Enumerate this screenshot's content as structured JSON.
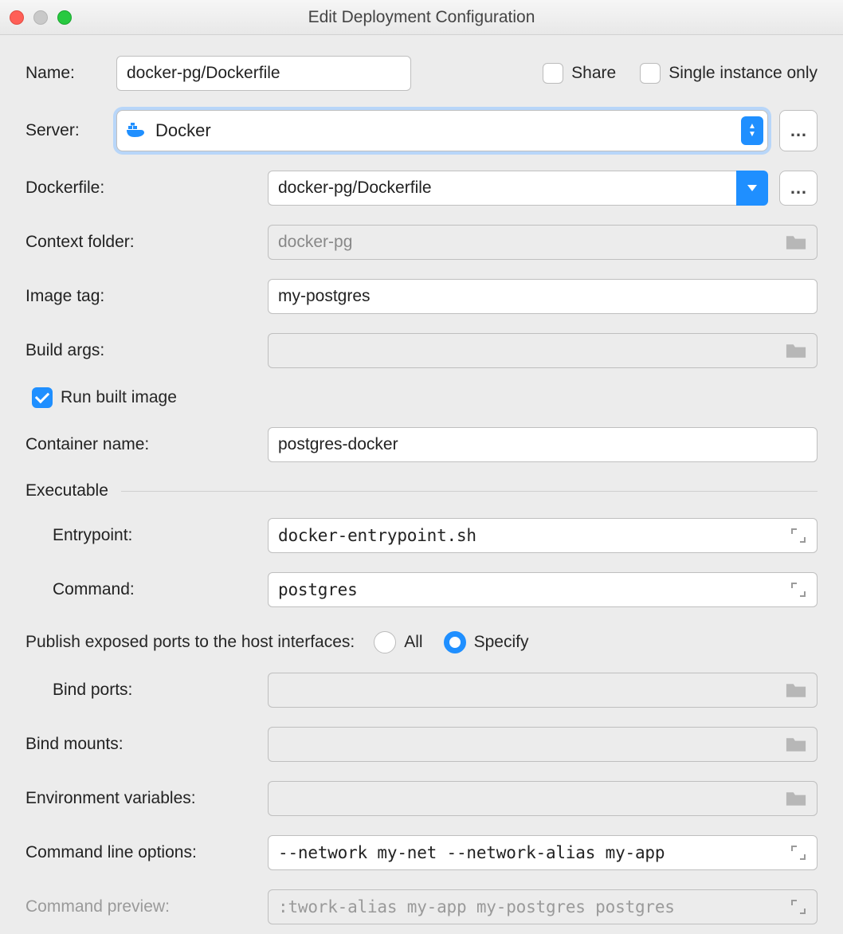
{
  "window": {
    "title": "Edit Deployment Configuration"
  },
  "name_row": {
    "label": "Name:",
    "value": "docker-pg/Dockerfile"
  },
  "share": {
    "label": "Share",
    "checked": false
  },
  "single_instance": {
    "label": "Single instance only",
    "checked": false
  },
  "server_row": {
    "label": "Server:",
    "selected": "Docker"
  },
  "dockerfile_row": {
    "label": "Dockerfile:",
    "selected": "docker-pg/Dockerfile"
  },
  "context_row": {
    "label": "Context folder:",
    "value": "docker-pg"
  },
  "image_tag_row": {
    "label": "Image tag:",
    "value": "my-postgres"
  },
  "build_args_row": {
    "label": "Build args:",
    "value": ""
  },
  "run_built": {
    "label": "Run built image",
    "checked": true
  },
  "container_name_row": {
    "label": "Container name:",
    "value": "postgres-docker"
  },
  "executable_section": {
    "label": "Executable"
  },
  "entrypoint_row": {
    "label": "Entrypoint:",
    "value": "docker-entrypoint.sh"
  },
  "command_row": {
    "label": "Command:",
    "value": "postgres"
  },
  "publish_ports": {
    "label": "Publish exposed ports to the host interfaces:",
    "options": {
      "all": "All",
      "specify": "Specify"
    },
    "selected": "specify"
  },
  "bind_ports_row": {
    "label": "Bind ports:",
    "value": ""
  },
  "bind_mounts_row": {
    "label": "Bind mounts:",
    "value": ""
  },
  "env_vars_row": {
    "label": "Environment variables:",
    "value": ""
  },
  "cli_options_row": {
    "label": "Command line options:",
    "value": "--network my-net --network-alias my-app"
  },
  "cmd_preview_row": {
    "label": "Command preview:",
    "value": ":twork-alias my-app my-postgres postgres"
  }
}
